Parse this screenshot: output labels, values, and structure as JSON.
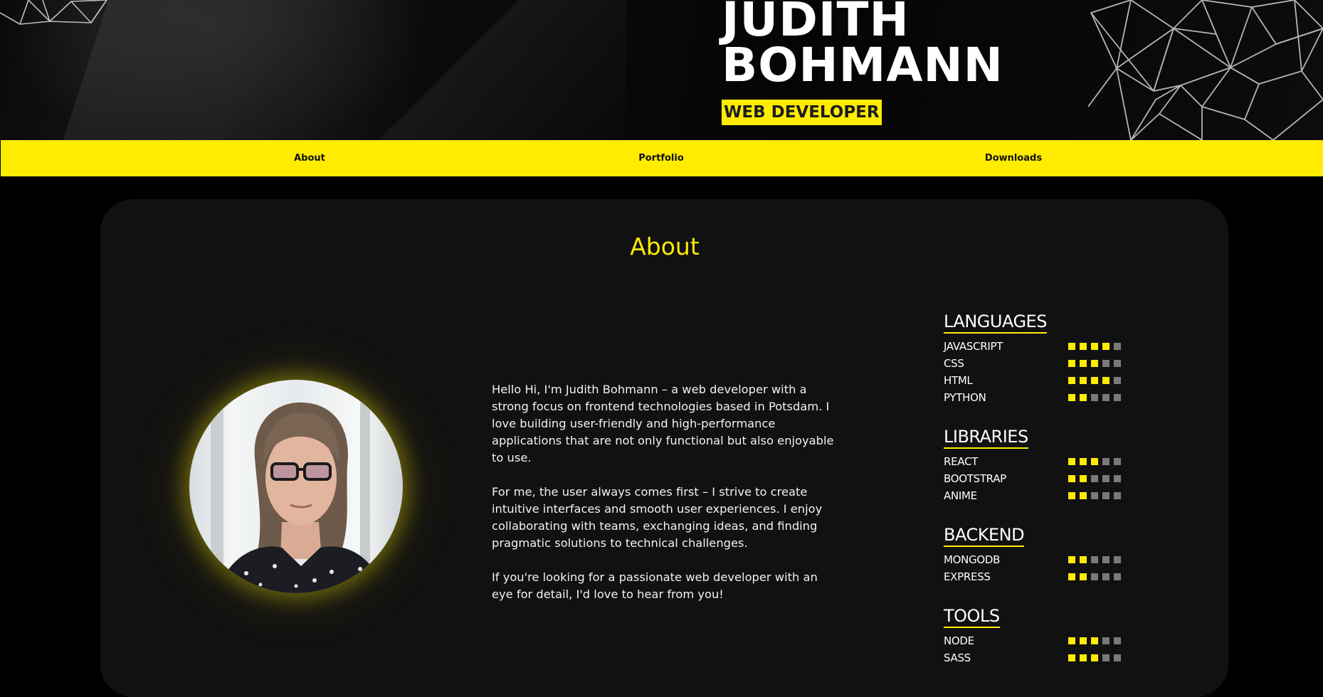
{
  "header": {
    "name_line1": "JUDITH",
    "name_line2": "BOHMANN",
    "role": "WEB DEVELOPER"
  },
  "nav": {
    "items": [
      {
        "label": "About"
      },
      {
        "label": "Portfolio"
      },
      {
        "label": "Downloads"
      }
    ]
  },
  "about": {
    "title": "About",
    "avatar_alt": "Portrait of Judith Bohmann",
    "paragraphs": [
      "Hello Hi, I'm Judith Bohmann – a web developer with a strong focus on frontend technologies based in Potsdam. I love building user-friendly and high-performance applications that are not only functional but also enjoyable to use.",
      "For me, the user always comes first – I strive to create intuitive interfaces and smooth user experiences. I enjoy collaborating with teams, exchanging ideas, and finding pragmatic solutions to technical challenges.",
      "If you're looking for a passionate web developer with an eye for detail, I'd love to hear from you!"
    ]
  },
  "skills": {
    "max_level": 5,
    "groups": [
      {
        "title": "LANGUAGES",
        "items": [
          {
            "name": "JAVASCRIPT",
            "level": 4
          },
          {
            "name": "CSS",
            "level": 3
          },
          {
            "name": "HTML",
            "level": 4
          },
          {
            "name": "PYTHON",
            "level": 2
          }
        ]
      },
      {
        "title": "LIBRARIES",
        "items": [
          {
            "name": "REACT",
            "level": 3
          },
          {
            "name": "BOOTSTRAP",
            "level": 2
          },
          {
            "name": "ANIME",
            "level": 2
          }
        ]
      },
      {
        "title": "BACKEND",
        "items": [
          {
            "name": "MONGODB",
            "level": 2
          },
          {
            "name": "EXPRESS",
            "level": 2
          }
        ]
      },
      {
        "title": "TOOLS",
        "items": [
          {
            "name": "NODE",
            "level": 3
          },
          {
            "name": "SASS",
            "level": 3
          }
        ]
      }
    ]
  },
  "colors": {
    "accent": "#ffec00",
    "background": "#000000",
    "card": "#111111",
    "dot_off": "#7a7a7a"
  }
}
